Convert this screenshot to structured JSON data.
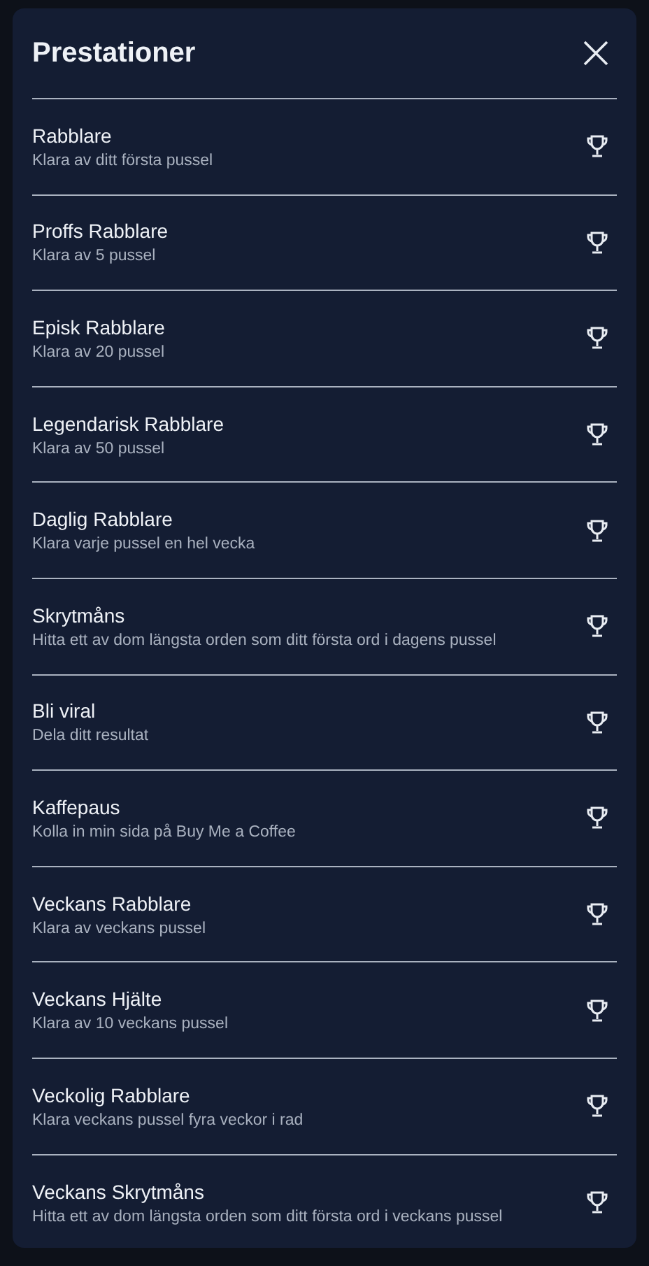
{
  "dialog": {
    "title": "Prestationer"
  },
  "achievements": [
    {
      "title": "Rabblare",
      "description": "Klara av ditt första pussel"
    },
    {
      "title": "Proffs Rabblare",
      "description": "Klara av 5 pussel"
    },
    {
      "title": "Episk Rabblare",
      "description": "Klara av 20 pussel"
    },
    {
      "title": "Legendarisk Rabblare",
      "description": "Klara av 50 pussel"
    },
    {
      "title": "Daglig Rabblare",
      "description": "Klara varje pussel en hel vecka"
    },
    {
      "title": "Skrytmåns",
      "description": "Hitta ett av dom längsta orden som ditt första ord i dagens pussel"
    },
    {
      "title": "Bli viral",
      "description": "Dela ditt resultat"
    },
    {
      "title": "Kaffepaus",
      "description": "Kolla in min sida på Buy Me a Coffee"
    },
    {
      "title": "Veckans Rabblare",
      "description": "Klara av veckans pussel"
    },
    {
      "title": "Veckans Hjälte",
      "description": "Klara av 10 veckans pussel"
    },
    {
      "title": "Veckolig Rabblare",
      "description": "Klara veckans pussel fyra veckor i rad"
    },
    {
      "title": "Veckans Skrytmåns",
      "description": "Hitta ett av dom längsta orden som ditt första ord i veckans pussel"
    }
  ]
}
